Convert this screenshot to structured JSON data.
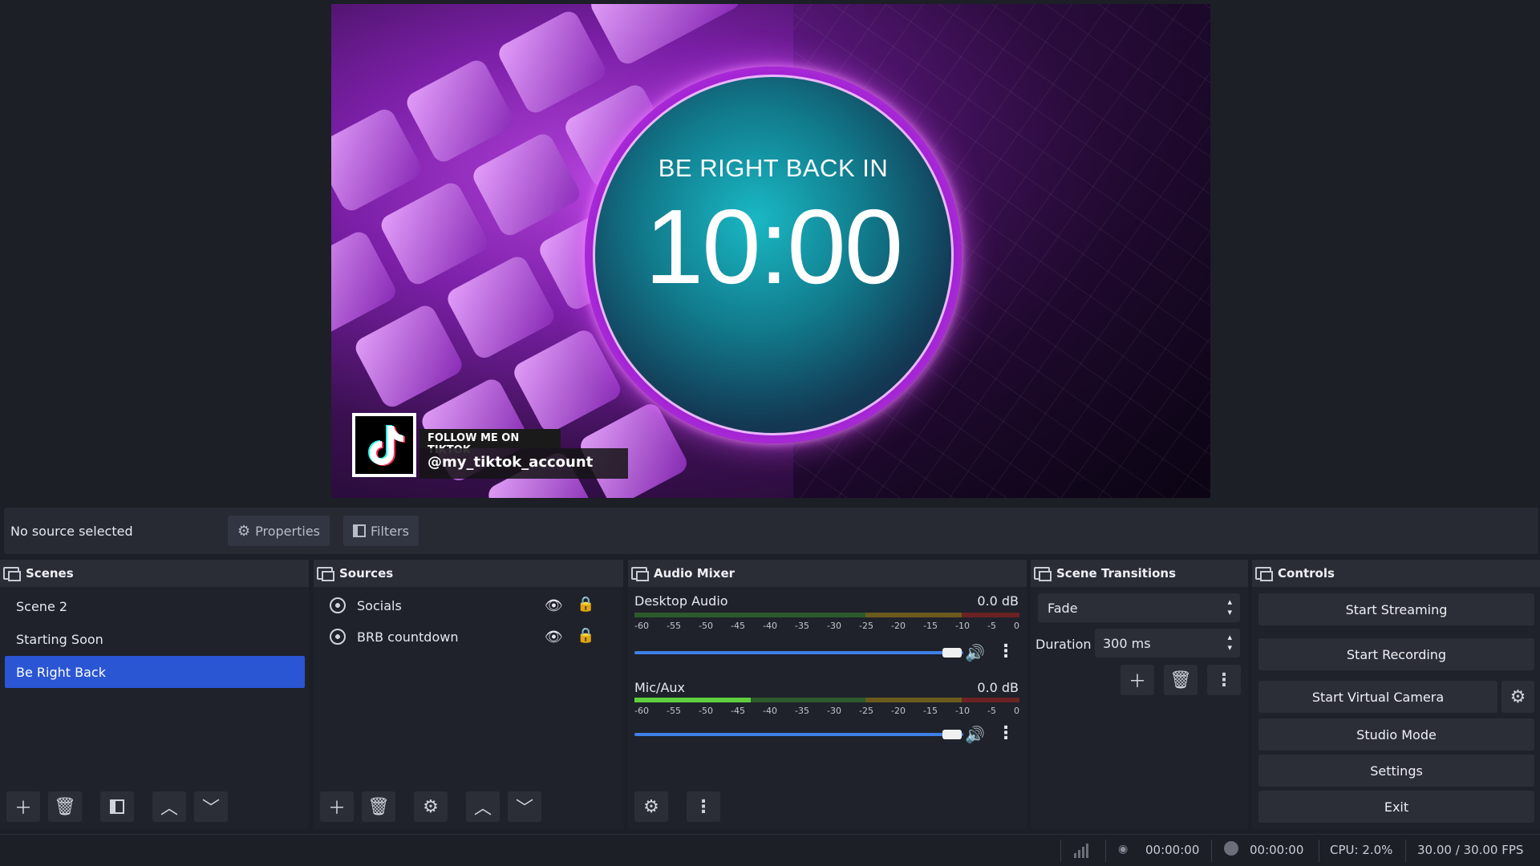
{
  "preview": {
    "timer_label": "BE RIGHT BACK IN",
    "timer_value": "10:00",
    "social_heading": "FOLLOW ME ON TIKTOK",
    "social_handle": "@my_tiktok_account"
  },
  "source_toolbar": {
    "no_source": "No source selected",
    "properties_label": "Properties",
    "filters_label": "Filters"
  },
  "scenes": {
    "title": "Scenes",
    "items": [
      "Scene 2",
      "Starting Soon",
      "Be Right Back"
    ],
    "selected": "Be Right Back"
  },
  "sources": {
    "title": "Sources",
    "items": [
      "Socials",
      "BRB countdown"
    ]
  },
  "audio_mixer": {
    "title": "Audio Mixer",
    "channels": [
      {
        "name": "Desktop Audio",
        "level": "0.0 dB",
        "volume": 1.0
      },
      {
        "name": "Mic/Aux",
        "level": "0.0 dB",
        "volume": 1.0
      }
    ],
    "ticks": [
      "-60",
      "-55",
      "-50",
      "-45",
      "-40",
      "-35",
      "-30",
      "-25",
      "-20",
      "-15",
      "-10",
      "-5",
      "0"
    ]
  },
  "transitions": {
    "title": "Scene Transitions",
    "selected": "Fade",
    "duration_label": "Duration",
    "duration_value": "300 ms"
  },
  "controls": {
    "title": "Controls",
    "start_streaming": "Start Streaming",
    "start_recording": "Start Recording",
    "start_virtual_camera": "Start Virtual Camera",
    "studio_mode": "Studio Mode",
    "settings": "Settings",
    "exit": "Exit"
  },
  "status": {
    "stream_time": "00:00:00",
    "record_time": "00:00:00",
    "cpu": "CPU: 2.0%",
    "fps": "30.00 / 30.00 FPS"
  },
  "colors": {
    "accent": "#2a56d4",
    "background": "#1c1f26",
    "panel": "#1f222a"
  }
}
